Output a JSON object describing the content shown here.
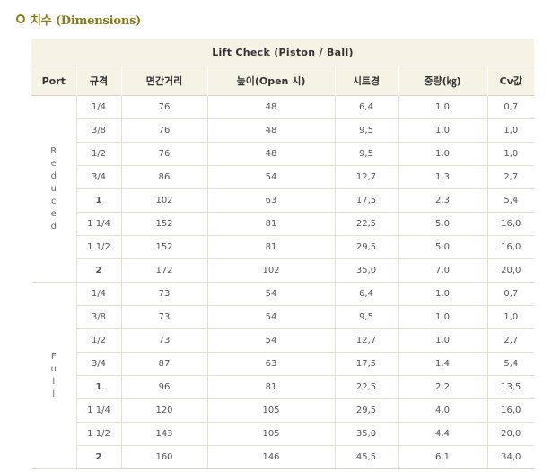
{
  "section": {
    "title": "치수 (Dimensions)"
  },
  "table": {
    "title": "Lift Check (Piston / Ball)",
    "headers": [
      "Port",
      "규격",
      "면간거리",
      "높이(Open 시)",
      "시트경",
      "중량(㎏)",
      "Cv값"
    ],
    "groups": [
      {
        "port": "Reduced",
        "rows": [
          [
            "1/4",
            "76",
            "48",
            "6,4",
            "1,0",
            "0,7"
          ],
          [
            "3/8",
            "76",
            "48",
            "9,5",
            "1,0",
            "1,0"
          ],
          [
            "1/2",
            "76",
            "48",
            "9,5",
            "1,0",
            "1,0"
          ],
          [
            "3/4",
            "86",
            "54",
            "12,7",
            "1,3",
            "2,7"
          ],
          [
            "1",
            "102",
            "63",
            "17,5",
            "2,3",
            "5,4"
          ],
          [
            "1 1/4",
            "152",
            "81",
            "22,5",
            "5,0",
            "16,0"
          ],
          [
            "1 1/2",
            "152",
            "81",
            "29,5",
            "5,0",
            "16,0"
          ],
          [
            "2",
            "172",
            "102",
            "35,0",
            "7,0",
            "20,0"
          ]
        ]
      },
      {
        "port": "Full",
        "rows": [
          [
            "1/4",
            "73",
            "54",
            "6,4",
            "1,0",
            "0,7"
          ],
          [
            "3/8",
            "73",
            "54",
            "9,5",
            "1,0",
            "1,0"
          ],
          [
            "1/2",
            "73",
            "54",
            "12,7",
            "1,0",
            "2,7"
          ],
          [
            "3/4",
            "87",
            "63",
            "17,5",
            "1,4",
            "5,4"
          ],
          [
            "1",
            "96",
            "81",
            "22,5",
            "2,2",
            "13,5"
          ],
          [
            "1 1/4",
            "120",
            "105",
            "29,5",
            "4,0",
            "16,0"
          ],
          [
            "1 1/2",
            "143",
            "105",
            "35,0",
            "4,4",
            "20,0"
          ],
          [
            "2",
            "160",
            "146",
            "45,5",
            "6,1",
            "34,0"
          ]
        ]
      }
    ]
  }
}
